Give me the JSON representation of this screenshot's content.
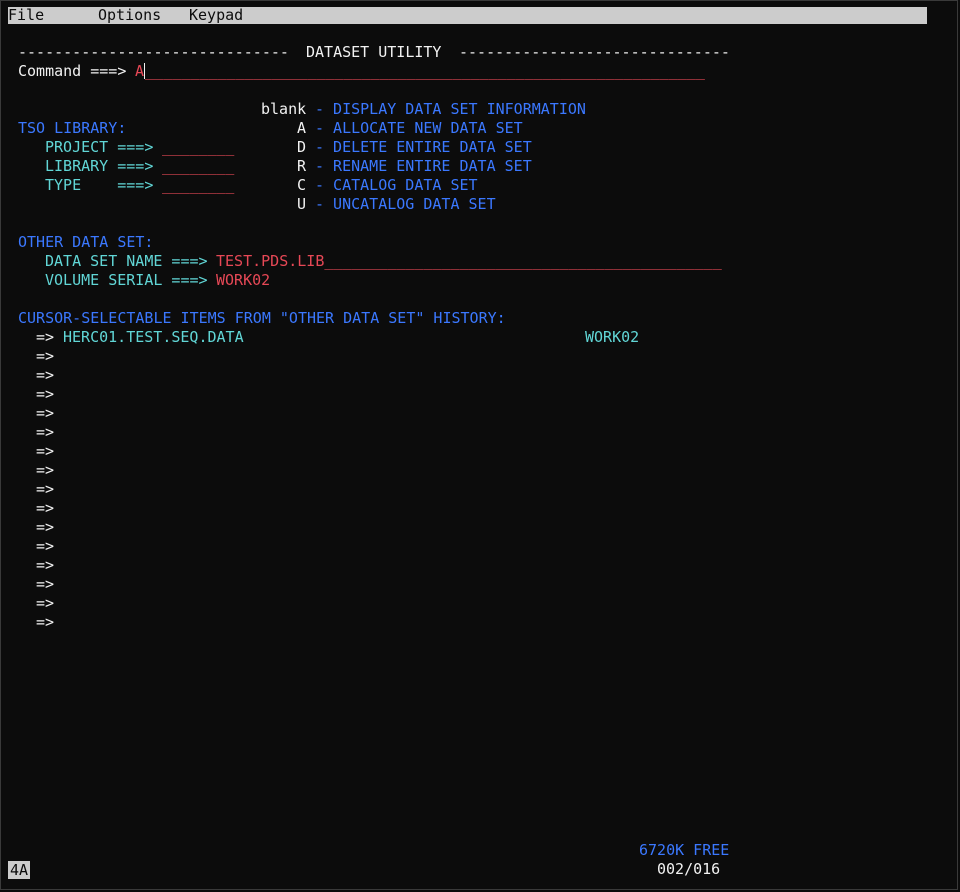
{
  "menu": {
    "file": "File",
    "options": "Options",
    "keypad": "Keypad"
  },
  "header": {
    "left_rule": "------------------------------",
    "title": "DATASET UTILITY",
    "right_rule": "------------------------------"
  },
  "command": {
    "label": "Command ===>",
    "value": "A",
    "underline": "______________________________________________________________"
  },
  "options": [
    {
      "key": "blank",
      "desc": "- DISPLAY DATA SET INFORMATION"
    },
    {
      "key": "A",
      "desc": "- ALLOCATE NEW DATA SET"
    },
    {
      "key": "D",
      "desc": "- DELETE ENTIRE DATA SET"
    },
    {
      "key": "R",
      "desc": "- RENAME ENTIRE DATA SET"
    },
    {
      "key": "C",
      "desc": "- CATALOG DATA SET"
    },
    {
      "key": "U",
      "desc": "- UNCATALOG DATA SET"
    }
  ],
  "tso_library": {
    "heading": "TSO LIBRARY:",
    "project_label": "PROJECT ===>",
    "project_value": "________",
    "library_label": "LIBRARY ===>",
    "library_value": "________",
    "type_label": "TYPE    ===>",
    "type_value": "________"
  },
  "other_data_set": {
    "heading": "OTHER DATA SET:",
    "dsn_label": "DATA SET NAME ===>",
    "dsn_value": "TEST.PDS.LIB",
    "dsn_underline": "____________________________________________",
    "volser_label": "VOLUME SERIAL ===>",
    "volser_value": "WORK02"
  },
  "history": {
    "heading": "CURSOR-SELECTABLE ITEMS FROM \"OTHER DATA SET\" HISTORY:",
    "arrow": "=>",
    "first_dataset": "HERC01.TEST.SEQ.DATA",
    "first_volume": "WORK02"
  },
  "footer": {
    "free": "6720K FREE",
    "position": "002/016",
    "status": "4A"
  }
}
